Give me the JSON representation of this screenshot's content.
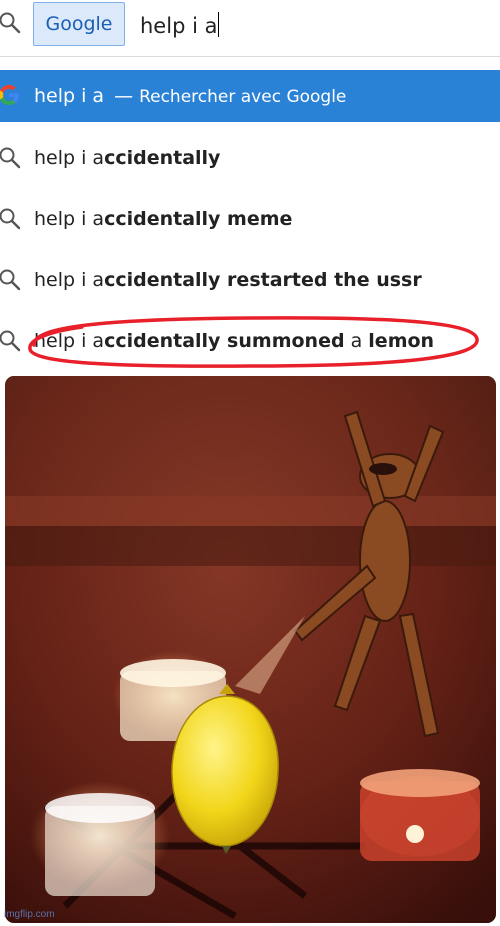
{
  "search": {
    "engine_label": "Google",
    "query": "help i a"
  },
  "suggestions": [
    {
      "prefix": "help i a",
      "separator": "—",
      "action": "Rechercher avec Google"
    },
    {
      "prefix": "help i a",
      "bold": "ccidentally"
    },
    {
      "prefix": "help i a",
      "bold": "ccidentally meme"
    },
    {
      "prefix": "help i a",
      "bold": "ccidentally restarted the ussr"
    },
    {
      "prefix": "help i a",
      "bold": "ccidentally summoned",
      "mid": " a ",
      "bold2": "lemon"
    }
  ],
  "colors": {
    "highlight": "#2a82d6",
    "circle": "#e8202a",
    "chip_bg": "#dbe9fa",
    "chip_text": "#1a5fb4"
  },
  "meme": {
    "watermark": "imgflip.com"
  }
}
